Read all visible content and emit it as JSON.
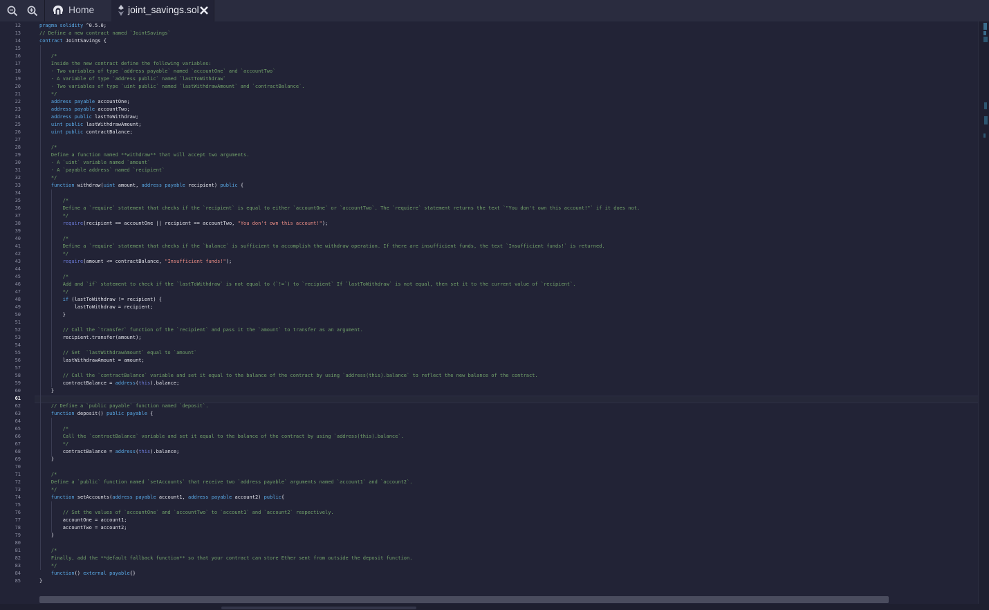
{
  "toolbar": {
    "zoom_out_icon": "zoom-out-icon",
    "zoom_in_icon": "zoom-in-icon"
  },
  "tabs": [
    {
      "label": "Home",
      "icon": "remix-logo-icon"
    },
    {
      "label": "joint_savings.sol",
      "icon": "solidity-file-icon",
      "close_icon": "close-icon"
    }
  ],
  "editor": {
    "current_line": 61,
    "line_numbers": [
      "12",
      "13",
      "14",
      "15",
      "16",
      "17",
      "18",
      "19",
      "20",
      "21",
      "22",
      "23",
      "24",
      "25",
      "26",
      "27",
      "28",
      "29",
      "30",
      "31",
      "32",
      "33",
      "34",
      "35",
      "36",
      "37",
      "38",
      "39",
      "40",
      "41",
      "42",
      "43",
      "44",
      "45",
      "46",
      "47",
      "48",
      "49",
      "50",
      "51",
      "52",
      "53",
      "54",
      "55",
      "56",
      "57",
      "58",
      "59",
      "60",
      "61",
      "62",
      "63",
      "64",
      "65",
      "66",
      "67",
      "68",
      "69",
      "70",
      "71",
      "72",
      "73",
      "74",
      "75",
      "76",
      "77",
      "78",
      "79",
      "80",
      "81",
      "82",
      "83",
      "84",
      "85"
    ],
    "code": [
      "pragma solidity ^0.5.0;",
      "// Define a new contract named `JointSavings`",
      "contract JointSavings {",
      "",
      "    /*",
      "    Inside the new contract define the following variables:",
      "    - Two variables of type `address payable` named `accountOne` and `accountTwo`",
      "    - A variable of type `address public` named `lastToWithdraw`",
      "    - Two variables of type `uint public` named `lastWithdrawAmount` and `contractBalance`.",
      "    */",
      "    address payable accountOne;",
      "    address payable accountTwo;",
      "    address public lastToWithdraw;",
      "    uint public lastWithdrawAmount;",
      "    uint public contractBalance;",
      "",
      "    /*",
      "    Define a function named **withdraw** that will accept two arguments.",
      "    - A `uint` variable named `amount`",
      "    - A `payable address` named `recipient`",
      "    */",
      "    function withdraw(uint amount, address payable recipient) public {",
      "",
      "        /*",
      "        Define a `require` statement that checks if the `recipient` is equal to either `accountOne` or `accountTwo`. The `requiere` statement returns the text `\"You don't own this account!\"` if it does not.",
      "        */",
      "        require(recipient == accountOne || recipient == accountTwo, \"You don't own this account!\");",
      "",
      "        /*",
      "        Define a `require` statement that checks if the `balance` is sufficient to accomplish the withdraw operation. If there are insufficient funds, the text `Insufficient funds!` is returned.",
      "        */",
      "        require(amount <= contractBalance, \"Insufficient funds!\");",
      "",
      "        /*",
      "        Add and `if` statement to check if the `lastToWithdraw` is not equal to (`!=`) to `recipient` If `lastToWithdraw` is not equal, then set it to the current value of `recipient`.",
      "        */",
      "        if (lastToWithdraw != recipient) {",
      "            lastToWithdraw = recipient;",
      "        }",
      "",
      "        // Call the `transfer` function of the `recipient` and pass it the `amount` to transfer as an argument.",
      "        recipient.transfer(amount);",
      "",
      "        // Set  `lastWithdrawAmount` equal to `amount`",
      "        lastWithdrawAmount = amount;",
      "",
      "        // Call the `contractBalance` variable and set it equal to the balance of the contract by using `address(this).balance` to reflect the new balance of the contract.",
      "        contractBalance = address(this).balance;",
      "    }",
      "",
      "    // Define a `public payable` function named `deposit`.",
      "    function deposit() public payable {",
      "",
      "        /*",
      "        Call the `contractBalance` variable and set it equal to the balance of the contract by using `address(this).balance`.",
      "        */",
      "        contractBalance = address(this).balance;",
      "    }",
      "",
      "    /*",
      "    Define a `public` function named `setAccounts` that receive two `address payable` arguments named `account1` and `account2`.",
      "    */",
      "    function setAccounts(address payable account1, address payable account2) public{",
      "",
      "        // Set the values of `accountOne` and `accountTwo` to `account1` and `account2` respectively.",
      "        accountOne = account1;",
      "        accountTwo = account2;",
      "    }",
      "",
      "    /*",
      "    Finally, add the **default fallback function** so that your contract can store Ether sent from outside the deposit function.",
      "    */",
      "    function() external payable{}",
      "}"
    ]
  }
}
